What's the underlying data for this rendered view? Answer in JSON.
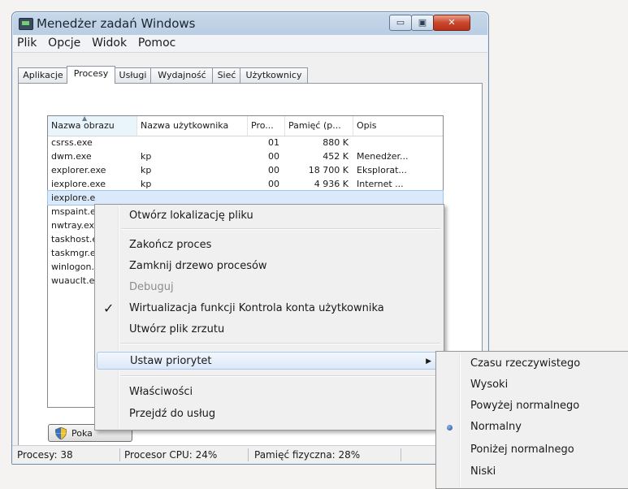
{
  "window": {
    "title": "Menedżer zadań Windows",
    "caption_buttons": {
      "minimize": "▭",
      "maximize": "▣",
      "close": "✕"
    }
  },
  "menubar": [
    "Plik",
    "Opcje",
    "Widok",
    "Pomoc"
  ],
  "tabs": [
    {
      "label": "Aplikacje",
      "active": false
    },
    {
      "label": "Procesy",
      "active": true
    },
    {
      "label": "Usługi",
      "active": false
    },
    {
      "label": "Wydajność",
      "active": false
    },
    {
      "label": "Sieć",
      "active": false
    },
    {
      "label": "Użytkownicy",
      "active": false
    }
  ],
  "processes": {
    "columns": [
      "Nazwa obrazu",
      "Nazwa użytkownika",
      "Pro...",
      "Pamięć (p...",
      "Opis"
    ],
    "rows": [
      {
        "name": "csrss.exe",
        "user": "",
        "cpu": "01",
        "mem": "880 K",
        "desc": ""
      },
      {
        "name": "dwm.exe",
        "user": "kp",
        "cpu": "00",
        "mem": "452 K",
        "desc": "Menedżer..."
      },
      {
        "name": "explorer.exe",
        "user": "kp",
        "cpu": "00",
        "mem": "18 700 K",
        "desc": "Eksplorat..."
      },
      {
        "name": "iexplore.exe",
        "user": "kp",
        "cpu": "00",
        "mem": "4 936 K",
        "desc": "Internet ..."
      },
      {
        "name": "iexplore.e",
        "user": "",
        "cpu": "",
        "mem": "",
        "desc": "",
        "selected": true
      },
      {
        "name": "mspaint.e",
        "user": "",
        "cpu": "",
        "mem": "",
        "desc": ""
      },
      {
        "name": "nwtray.ex",
        "user": "",
        "cpu": "",
        "mem": "",
        "desc": ""
      },
      {
        "name": "taskhost.e",
        "user": "",
        "cpu": "",
        "mem": "",
        "desc": ""
      },
      {
        "name": "taskmgr.e",
        "user": "",
        "cpu": "",
        "mem": "",
        "desc": ""
      },
      {
        "name": "winlogon.",
        "user": "",
        "cpu": "",
        "mem": "",
        "desc": ""
      },
      {
        "name": "wuauclt.e",
        "user": "",
        "cpu": "",
        "mem": "",
        "desc": ""
      }
    ]
  },
  "show_all_button": "Poka",
  "statusbar": {
    "processes": "Procesy: 38",
    "cpu": "Procesor CPU: 24%",
    "memory": "Pamięć fizyczna: 28%"
  },
  "context_menu": {
    "open_location": "Otwórz lokalizację pliku",
    "end_process": "Zakończ proces",
    "end_tree": "Zamknij drzewo procesów",
    "debug": "Debuguj",
    "virtualization": "Wirtualizacja funkcji Kontrola konta użytkownika",
    "dump": "Utwórz plik zrzutu",
    "set_priority": "Ustaw priorytet",
    "properties": "Właściwości",
    "goto_services": "Przejdź do usług"
  },
  "priority_menu": [
    "Czasu rzeczywistego",
    "Wysoki",
    "Powyżej normalnego",
    "Normalny",
    "Poniżej normalnego",
    "Niski"
  ],
  "priority_selected": "Normalny"
}
